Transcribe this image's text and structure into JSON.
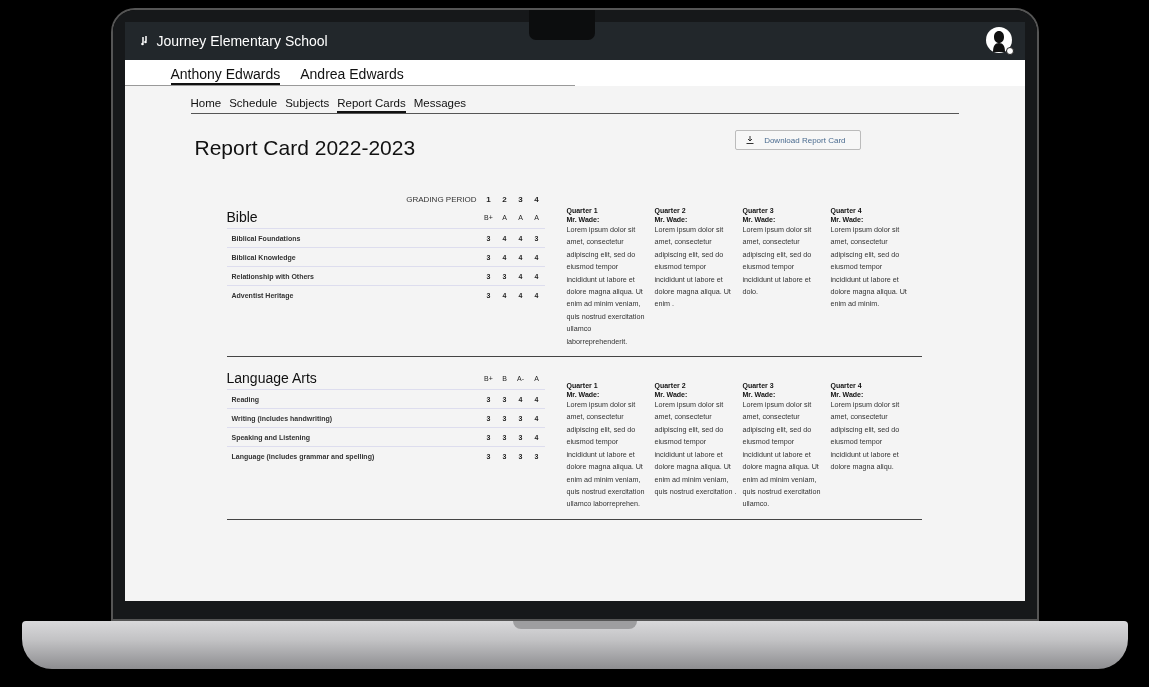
{
  "header": {
    "school": "Journey Elementary School"
  },
  "students": [
    {
      "name": "Anthony Edwards",
      "selected": true
    },
    {
      "name": "Andrea Edwards",
      "selected": false
    }
  ],
  "nav": [
    {
      "label": "Home",
      "selected": false
    },
    {
      "label": "Schedule",
      "selected": false
    },
    {
      "label": "Subjects",
      "selected": false
    },
    {
      "label": "Report Cards",
      "selected": true
    },
    {
      "label": "Messages",
      "selected": false
    }
  ],
  "title": "Report Card 2022-2023",
  "download_button": "Download Report Card",
  "grading_period_label": "GRADING PERIOD",
  "periods": [
    "1",
    "2",
    "3",
    "4"
  ],
  "subjects": [
    {
      "name": "Bible",
      "grades": [
        "B+",
        "A",
        "A",
        "A"
      ],
      "items": [
        {
          "name": "Biblical Foundations",
          "scores": [
            "3",
            "4",
            "4",
            "3"
          ]
        },
        {
          "name": "Biblical Knowledge",
          "scores": [
            "3",
            "4",
            "4",
            "4"
          ]
        },
        {
          "name": "Relationship with Others",
          "scores": [
            "3",
            "3",
            "4",
            "4"
          ]
        },
        {
          "name": "Adventist Heritage",
          "scores": [
            "3",
            "4",
            "4",
            "4"
          ]
        }
      ],
      "comments": [
        {
          "quarter": "Quarter 1",
          "teacher": "Mr. Wade:",
          "text": "Lorem ipsum dolor sit amet, consectetur adipiscing elit, sed do eiusmod tempor incididunt ut labore et dolore magna aliqua. Ut enim ad minim veniam, quis nostrud exercitation ullamco laborreprehenderit."
        },
        {
          "quarter": "Quarter 2",
          "teacher": "Mr. Wade:",
          "text": "Lorem ipsum dolor sit amet, consectetur adipiscing elit, sed do eiusmod tempor incididunt ut labore et dolore magna aliqua. Ut enim ."
        },
        {
          "quarter": "Quarter 3",
          "teacher": "Mr. Wade:",
          "text": "Lorem ipsum dolor sit amet, consectetur adipiscing elit, sed do eiusmod tempor incididunt ut labore et dolo."
        },
        {
          "quarter": "Quarter 4",
          "teacher": "Mr. Wade:",
          "text": "Lorem ipsum dolor sit amet, consectetur adipiscing elit, sed do eiusmod tempor incididunt ut labore et dolore magna aliqua. Ut enim ad minim."
        }
      ]
    },
    {
      "name": "Language Arts",
      "grades": [
        "B+",
        "B",
        "A-",
        "A"
      ],
      "items": [
        {
          "name": "Reading",
          "scores": [
            "3",
            "3",
            "4",
            "4"
          ]
        },
        {
          "name": "Writing (includes handwriting)",
          "scores": [
            "3",
            "3",
            "3",
            "4"
          ]
        },
        {
          "name": "Speaking and Listening",
          "scores": [
            "3",
            "3",
            "3",
            "4"
          ]
        },
        {
          "name": "Language (includes grammar and spelling)",
          "scores": [
            "3",
            "3",
            "3",
            "3"
          ]
        }
      ],
      "comments": [
        {
          "quarter": "Quarter 1",
          "teacher": "Mr. Wade:",
          "text": "Lorem ipsum dolor sit amet, consectetur adipiscing elit, sed do eiusmod tempor incididunt ut labore et dolore magna aliqua. Ut enim ad minim veniam, quis nostrud exercitation ullamco laborreprehen."
        },
        {
          "quarter": "Quarter 2",
          "teacher": "Mr. Wade:",
          "text": "Lorem ipsum dolor sit amet, consectetur adipiscing elit, sed do eiusmod tempor incididunt ut labore et dolore magna aliqua. Ut enim ad minim veniam, quis nostrud exercitation ."
        },
        {
          "quarter": "Quarter 3",
          "teacher": "Mr. Wade:",
          "text": "Lorem ipsum dolor sit amet, consectetur adipiscing elit, sed do eiusmod tempor incididunt ut labore et dolore magna aliqua. Ut enim ad minim veniam, quis nostrud exercitation ullamco."
        },
        {
          "quarter": "Quarter 4",
          "teacher": "Mr. Wade:",
          "text": "Lorem ipsum dolor sit amet, consectetur adipiscing elit, sed do eiusmod tempor incididunt ut labore et dolore magna aliqu."
        }
      ]
    }
  ]
}
